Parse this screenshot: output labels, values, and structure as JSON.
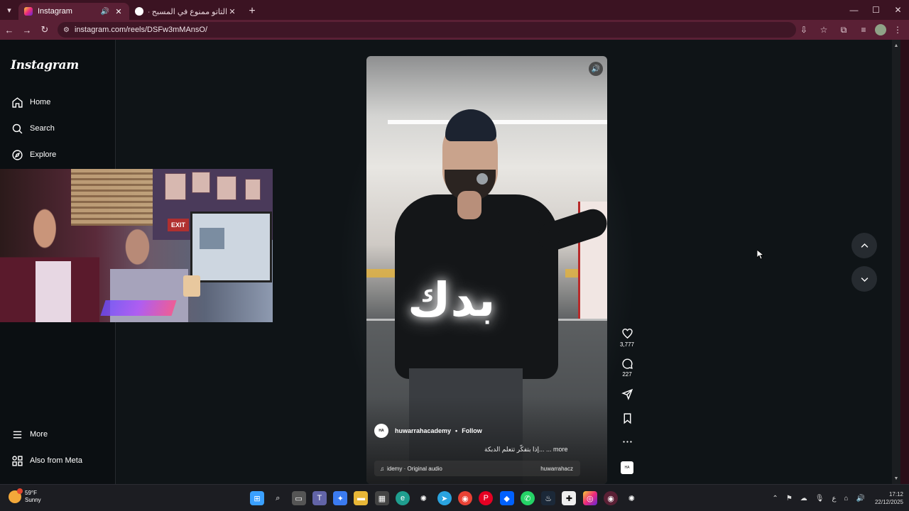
{
  "browser": {
    "tabs": [
      {
        "title": "Instagram",
        "active": true,
        "favicon_color": "#e1306c"
      },
      {
        "title": "التاتو ممنوع في المسبح - Search",
        "active": false,
        "favicon_color": "#ffffff"
      }
    ],
    "url": "instagram.com/reels/DSFw3mMAnsO/"
  },
  "sidebar": {
    "logo": "Instagram",
    "items": [
      {
        "label": "Home",
        "icon": "home-icon"
      },
      {
        "label": "Search",
        "icon": "search-icon"
      },
      {
        "label": "Explore",
        "icon": "compass-icon"
      }
    ],
    "bottom_items": [
      {
        "label": "More",
        "icon": "menu-icon"
      },
      {
        "label": "Also from Meta",
        "icon": "apps-icon"
      }
    ]
  },
  "webcam": {
    "sign_text": "EXIT"
  },
  "reel": {
    "overlay_text": "بدك",
    "author": "huwarrahacademy",
    "follow_label": "Follow",
    "caption": "إذا بتفكّر تتعلم الدبكة... ... more",
    "audio_label": "idemy · Original audio",
    "audio_right": "huwarrahacz",
    "likes": "3,777",
    "comments": "227"
  },
  "taskbar": {
    "temperature": "59°F",
    "condition": "Sunny",
    "time": "17:12",
    "date": "22/12/2025"
  },
  "colors": {
    "tabstrip": "#3b1322",
    "toolbar": "#5a2035",
    "page_bg": "#0f1417"
  }
}
